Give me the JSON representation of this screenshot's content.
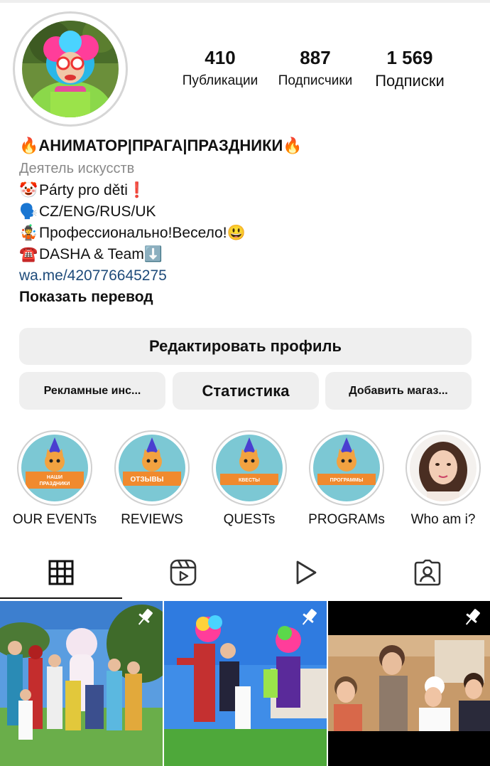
{
  "profile": {
    "stats": [
      {
        "value": "410",
        "label": "Публикации"
      },
      {
        "value": "887",
        "label": "Подписчики"
      },
      {
        "value": "1 569",
        "label": "Подписки"
      }
    ]
  },
  "bio": {
    "name": "АНИМАТОР|ПРАГА|ПРАЗДНИКИ",
    "name_emoji_left": "🔥",
    "name_emoji_right": "🔥",
    "category": "Деятель искусств",
    "lines": [
      {
        "emoji": "🤡",
        "text": "Párty pro děti",
        "emoji_after": "❗"
      },
      {
        "emoji": "🗣️",
        "text": "CZ/ENG/RUS/UK",
        "emoji_after": ""
      },
      {
        "emoji": "🤹",
        "text": "Профессионально!Весело!",
        "emoji_after": "😃"
      },
      {
        "emoji": "☎️",
        "text": "DASHA & Team",
        "emoji_after": "⬇️"
      }
    ],
    "link": "wa.me/420776645275",
    "show_translation": "Показать перевод"
  },
  "buttons": {
    "edit_profile": "Редактировать профиль",
    "ads": "Рекламные инс...",
    "statistics": "Статистика",
    "add_shop": "Добавить магаз..."
  },
  "highlights": [
    {
      "label": "OUR EVENTs",
      "cover_text": "НАШИ ПРАЗДНИКИ"
    },
    {
      "label": "REVIEWS",
      "cover_text": "ОТЗЫВЫ"
    },
    {
      "label": "QUESTs",
      "cover_text": "КВЕСТЫ"
    },
    {
      "label": "PROGRAMs",
      "cover_text": "ПРОГРАММЫ"
    },
    {
      "label": "Who am i?",
      "cover_text": ""
    }
  ],
  "tabs": [
    {
      "icon": "grid-icon",
      "active": true
    },
    {
      "icon": "reels-icon",
      "active": false
    },
    {
      "icon": "video-icon",
      "active": false
    },
    {
      "icon": "tagged-icon",
      "active": false
    }
  ],
  "posts": [
    {
      "pinned": true
    },
    {
      "pinned": true
    },
    {
      "pinned": true
    }
  ]
}
